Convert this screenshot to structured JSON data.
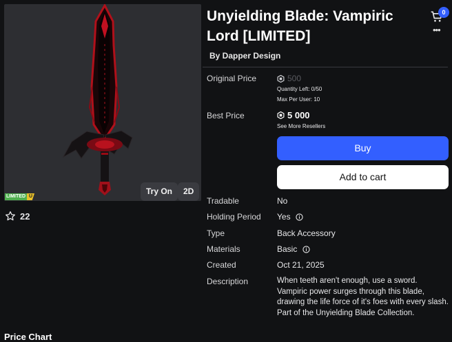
{
  "item": {
    "title": "Unyielding Blade: Vampiric Lord [LIMITED]",
    "creator": "By Dapper Design"
  },
  "thumbnail": {
    "limited_tag": "LIMITED",
    "limited_u": "U",
    "try_on_label": "Try On",
    "view_2d_label": "2D"
  },
  "favorites": {
    "count": "22"
  },
  "header": {
    "cart_count": "0"
  },
  "pricing": {
    "original_price_label": "Original Price",
    "original_price": "500",
    "quantity_left": "Quantity Left: 0/50",
    "max_per_user": "Max Per User: 10",
    "best_price_label": "Best Price",
    "best_price": "5 000",
    "see_more_resellers": "See More Resellers"
  },
  "actions": {
    "buy_label": "Buy",
    "add_to_cart_label": "Add to cart"
  },
  "details": {
    "tradable_label": "Tradable",
    "tradable_value": "No",
    "holding_label": "Holding Period",
    "holding_value": "Yes",
    "type_label": "Type",
    "type_value": "Back Accessory",
    "materials_label": "Materials",
    "materials_value": "Basic",
    "created_label": "Created",
    "created_value": "Oct 21, 2025",
    "description_label": "Description",
    "description_value": "When teeth aren't enough, use a sword. Vampiric power surges through this blade, drawing the life force of it's foes with every slash. Part of the Unyielding Blade Collection."
  },
  "sections": {
    "price_chart": "Price Chart"
  },
  "colors": {
    "background": "#111214",
    "thumbnail_bg": "#2d2e32",
    "buy_button": "#335fff",
    "cart_button": "#ffffff",
    "limited_green": "#4fb04f",
    "limited_yellow": "#e8c02a"
  },
  "icons": [
    "cart-icon",
    "more-options-icon",
    "robux-icon",
    "star-icon",
    "info-icon"
  ]
}
